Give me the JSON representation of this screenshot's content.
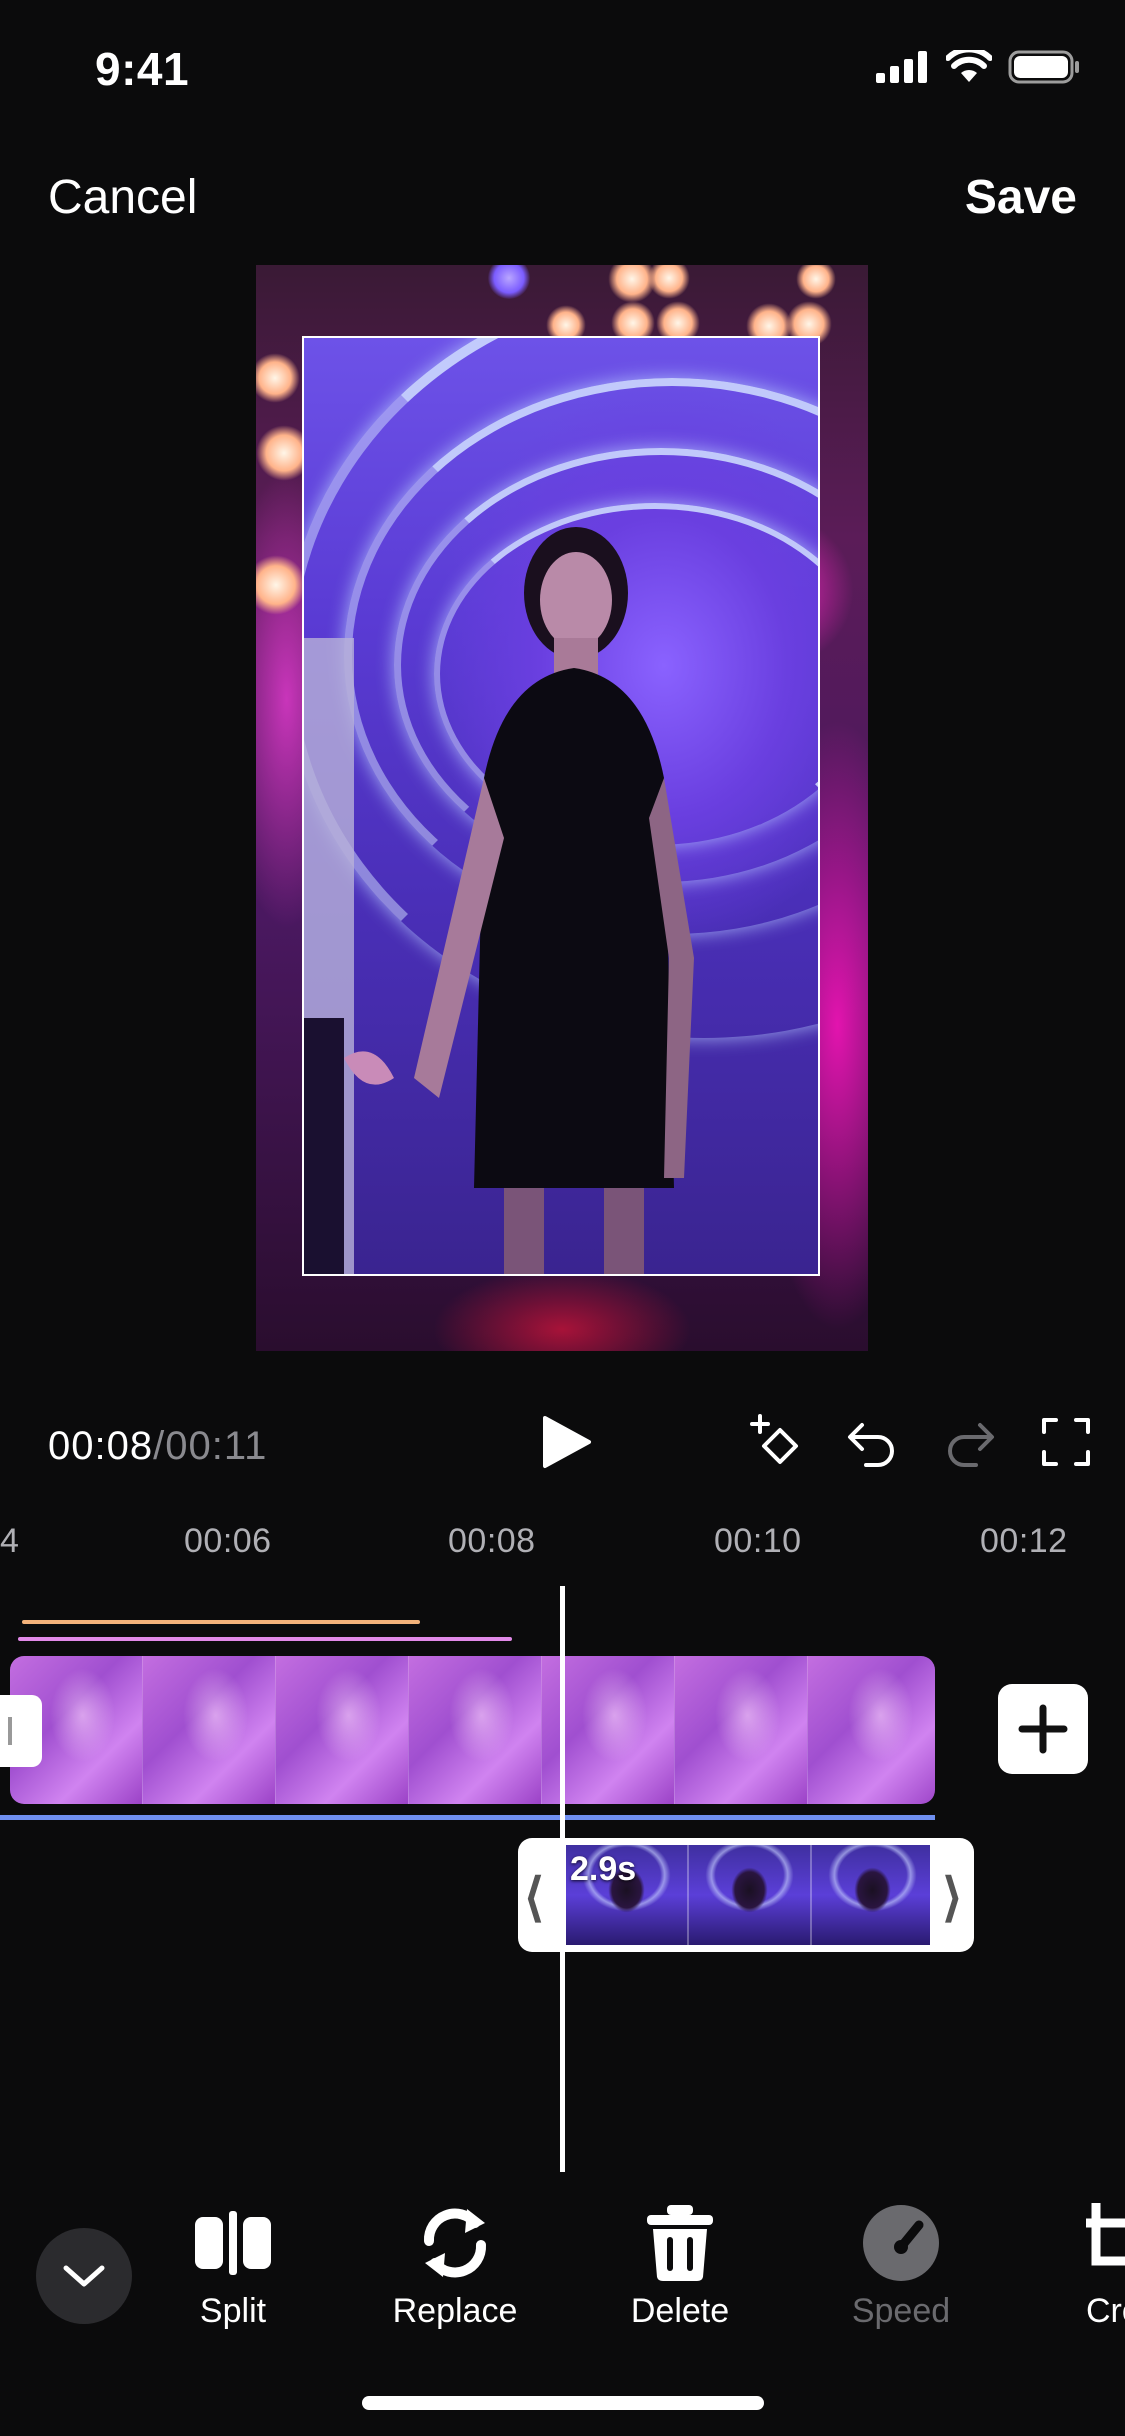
{
  "status": {
    "time": "9:41",
    "icons": [
      "signal-icon",
      "wifi-icon",
      "battery-icon"
    ]
  },
  "header": {
    "cancel_label": "Cancel",
    "save_label": "Save"
  },
  "player": {
    "current_time": "00:08",
    "separator": "/",
    "total_time": "00:11",
    "controls": [
      "play-icon",
      "add-keyframe-icon",
      "undo-icon",
      "redo-icon",
      "fullscreen-icon"
    ]
  },
  "ruler": {
    "ticks": [
      "4",
      "00:06",
      "00:08",
      "00:10",
      "00:12"
    ]
  },
  "timeline": {
    "selected_clip_duration": "2.9s",
    "accent_colors": {
      "audio_orange": "#f3b27a",
      "audio_pink": "#e18ae8",
      "main_track_line": "#6f8ff0"
    }
  },
  "toolbar": {
    "items": [
      {
        "label": "Split",
        "icon": "split-icon",
        "enabled": true
      },
      {
        "label": "Replace",
        "icon": "replace-icon",
        "enabled": true
      },
      {
        "label": "Delete",
        "icon": "trash-icon",
        "enabled": true
      },
      {
        "label": "Speed",
        "icon": "speed-icon",
        "enabled": false
      },
      {
        "label": "Cro",
        "icon": "crop-icon",
        "enabled": true
      }
    ]
  }
}
